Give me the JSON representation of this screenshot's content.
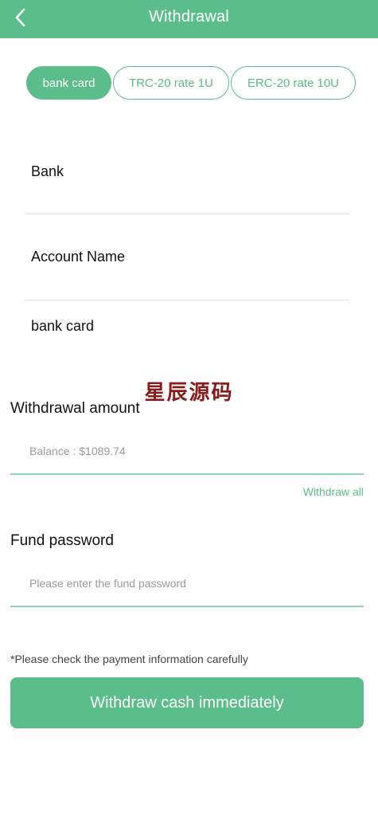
{
  "header": {
    "title": "Withdrawal"
  },
  "tabs": [
    {
      "label": "bank card",
      "active": true
    },
    {
      "label": "TRC-20 rate 1U",
      "active": false
    },
    {
      "label": "ERC-20 rate 10U",
      "active": false
    }
  ],
  "bank_info": {
    "bank_label": "Bank",
    "account_name_label": "Account Name",
    "bank_card_label": "bank card"
  },
  "watermark": "星辰源码",
  "amount": {
    "label": "Withdrawal amount",
    "placeholder": "Balance : $1089.74",
    "withdraw_all": "Withdraw all"
  },
  "password": {
    "label": "Fund password",
    "placeholder": "Please enter the fund password"
  },
  "notice": "*Please check the payment information carefully",
  "submit_label": "Withdraw cash immediately",
  "colors": {
    "accent": "#5bbd8a",
    "watermark": "#8b1b1b"
  }
}
